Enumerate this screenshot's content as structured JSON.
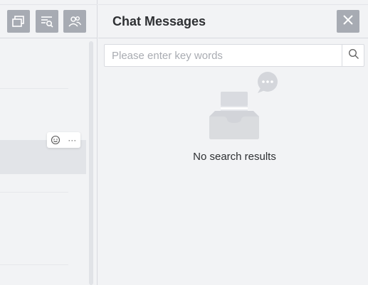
{
  "left_toolbar": {
    "buttons": [
      {
        "icon": "window-icon"
      },
      {
        "icon": "filter-search-icon"
      },
      {
        "icon": "members-icon"
      }
    ]
  },
  "message_actions": {
    "emoji_icon": "smile-icon",
    "more_label": "···"
  },
  "panel": {
    "title": "Chat Messages",
    "close_icon": "close-icon"
  },
  "search": {
    "placeholder": "Please enter key words",
    "value": "",
    "icon": "search-icon"
  },
  "empty_state": {
    "message": "No search results",
    "icon": "empty-inbox-icon"
  },
  "colors": {
    "background": "#f2f3f5",
    "button_gray": "#a7abb3",
    "title_text": "#2e3033"
  }
}
